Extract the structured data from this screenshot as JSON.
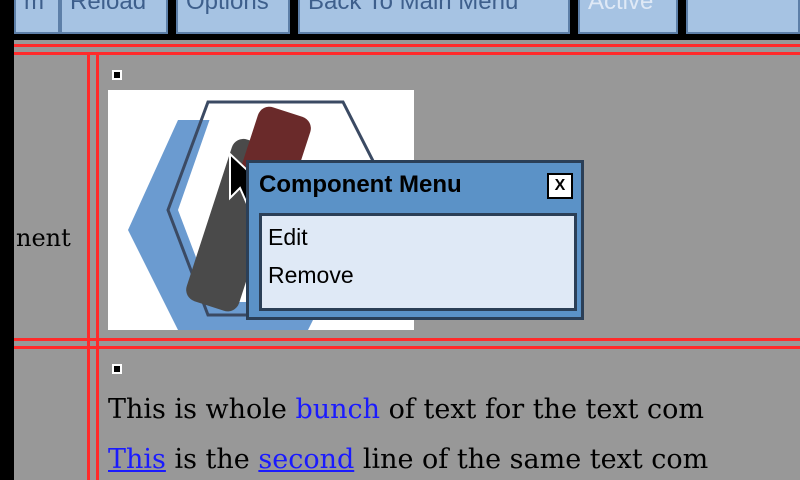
{
  "tabs": [
    {
      "label": "m"
    },
    {
      "label": "Reload"
    },
    {
      "label": "Options"
    },
    {
      "label": "Back To Main Menu"
    },
    {
      "label": "Active"
    }
  ],
  "left_cell_label": "nent",
  "component_menu": {
    "title": "Component Menu",
    "close_label": "X",
    "items": [
      "Edit",
      "Remove"
    ]
  },
  "text_component": {
    "line1_a": "This is whole ",
    "line1_link": "bunch",
    "line1_b": " of text for the text com",
    "line2_link1": "This",
    "line2_a": " is the ",
    "line2_link2": "second",
    "line2_b": " line of the same text com"
  },
  "colors": {
    "tab_bg": "#a6c3e3",
    "grid_red": "#ff2a2a",
    "menu_blue": "#5b92c7",
    "link_blue": "#1a1aff"
  }
}
